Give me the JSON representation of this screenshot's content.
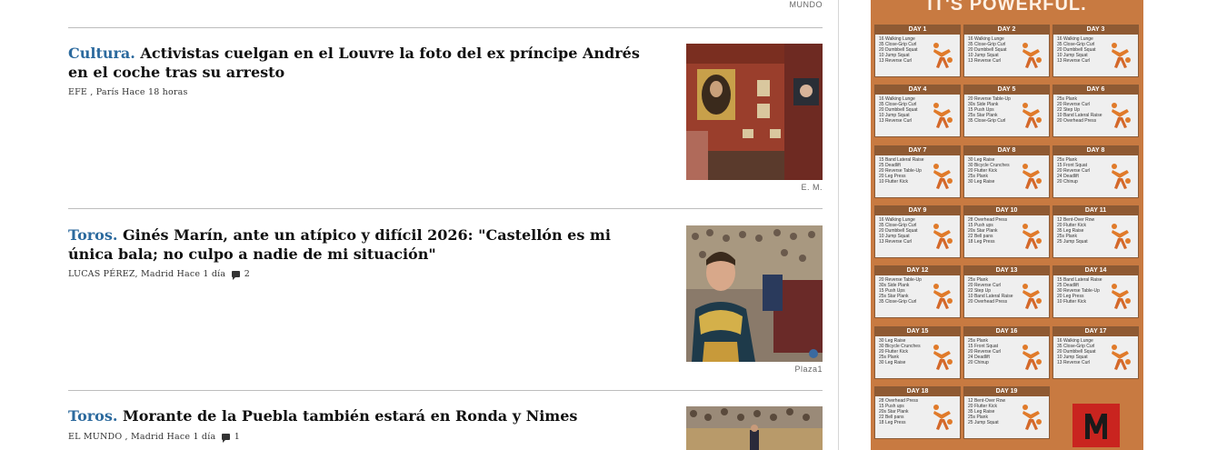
{
  "section": {
    "label": "MUNDO"
  },
  "articles": [
    {
      "kicker": "Cultura.",
      "title": "Activistas cuelgan en el Louvre la foto del ex príncipe Andrés en el coche tras su arresto",
      "byline": "EFE , París",
      "time": "Hace 18 horas",
      "comments": "",
      "credit": "E. M."
    },
    {
      "kicker": "Toros.",
      "title": "Ginés Marín, ante un atípico y difícil 2026: \"Castellón es mi única bala; no culpo a nadie de mi situación\"",
      "byline": "LUCAS PÉREZ, Madrid",
      "time": "Hace 1 día",
      "comments": "2",
      "credit": "Plaza1"
    },
    {
      "kicker": "Toros.",
      "title": "Morante de la Puebla también estará en Ronda y Nimes",
      "byline": "EL MUNDO , Madrid",
      "time": "Hace 1 día",
      "comments": "1",
      "credit": ""
    }
  ],
  "ad": {
    "title": "IT'S POWERFUL.",
    "days": [
      {
        "label": "DAY 1",
        "items": [
          "16 Walking Lunge",
          "35 Close-Grip Curl",
          "20 Dumbbell Squat",
          "10 Jump Squat",
          "13 Reverse Curl"
        ]
      },
      {
        "label": "DAY 2",
        "items": [
          "16 Walking Lunge",
          "35 Close-Grip Curl",
          "20 Dumbbell Squat",
          "10 Jump Squat",
          "13 Reverse Curl"
        ]
      },
      {
        "label": "DAY 3",
        "items": [
          "16 Walking Lunge",
          "35 Close-Grip Curl",
          "20 Dumbbell Squat",
          "10 Jump Squat",
          "13 Reverse Curl"
        ]
      },
      {
        "label": "DAY 4",
        "items": [
          "16 Walking Lunge",
          "35 Close-Grip Curl",
          "20 Dumbbell Squat",
          "10 Jump Squat",
          "13 Reverse Curl"
        ]
      },
      {
        "label": "DAY 5",
        "items": [
          "20 Reverse Table-Up",
          "30s Side Plank",
          "15 Push Ups",
          "25s Star Plank",
          "35 Close-Grip Curl"
        ]
      },
      {
        "label": "DAY 6",
        "items": [
          "25s Plank",
          "20 Reverse Curl",
          "22 Step Up",
          "10 Band Lateral Raise",
          "20 Overhead Press"
        ]
      },
      {
        "label": "DAY 7",
        "items": [
          "15 Band Lateral Raise",
          "25 Deadlift",
          "20 Reverse Table-Up",
          "20 Leg Press",
          "10 Flutter Kick"
        ]
      },
      {
        "label": "DAY 8",
        "items": [
          "30 Leg Raise",
          "30 Bicycle Crunches",
          "20 Flutter Kick",
          "25s Plank",
          "30 Leg Raise"
        ]
      },
      {
        "label": "DAY 8",
        "items": [
          "25s Plank",
          "15 Front Squat",
          "20 Reverse Curl",
          "24 Deadlift",
          "20 Chinup"
        ]
      },
      {
        "label": "DAY 9",
        "items": [
          "16 Walking Lunge",
          "35 Close-Grip Curl",
          "20 Dumbbell Squat",
          "10 Jump Squat",
          "13 Reverse Curl"
        ]
      },
      {
        "label": "DAY 10",
        "items": [
          "28 Overhead Press",
          "15 Push ups",
          "20s Star Plank",
          "22 Bell pans",
          "18 Leg Press"
        ]
      },
      {
        "label": "DAY 11",
        "items": [
          "12 Bent-Over Row",
          "20 Flutter Kick",
          "35 Leg Raise",
          "25s Plank",
          "25 Jump Squat"
        ]
      },
      {
        "label": "DAY 12",
        "items": [
          "20 Reverse Table-Up",
          "30s Side Plank",
          "15 Push Ups",
          "25s Star Plank",
          "35 Close-Grip Curl"
        ]
      },
      {
        "label": "DAY 13",
        "items": [
          "25s Plank",
          "20 Reverse Curl",
          "22 Step Up",
          "10 Band Lateral Raise",
          "20 Overhead Press"
        ]
      },
      {
        "label": "DAY 14",
        "items": [
          "15 Band Lateral Raise",
          "25 Deadlift",
          "30 Reverse Table-Up",
          "20 Leg Press",
          "10 Flutter Kick"
        ]
      },
      {
        "label": "DAY 15",
        "items": [
          "30 Leg Raise",
          "30 Bicycle Crunches",
          "20 Flutter Kick",
          "25s Plank",
          "30 Leg Raise"
        ]
      },
      {
        "label": "DAY 16",
        "items": [
          "25s Plank",
          "15 Front Squat",
          "20 Reverse Curl",
          "24 Deadlift",
          "20 Chinup"
        ]
      },
      {
        "label": "DAY 17",
        "items": [
          "16 Walking Lunge",
          "35 Close-Grip Curl",
          "20 Dumbbell Squat",
          "10 Jump Squat",
          "13 Reverse Curl"
        ]
      },
      {
        "label": "DAY 18",
        "items": [
          "28 Overhead Press",
          "15 Push ups",
          "20s Star Plank",
          "22 Bell pans",
          "18 Leg Press"
        ]
      },
      {
        "label": "DAY 19",
        "items": [
          "12 Bent-Over Row",
          "20 Flutter Kick",
          "35 Leg Raise",
          "25s Plank",
          "25 Jump Squat"
        ]
      }
    ]
  },
  "colors": {
    "kicker": "#2c6a9e",
    "ad_bg": "#c87a41",
    "ad_header": "#8f5a33",
    "logo": "#c9241f"
  },
  "icons": {
    "comment": "comment-icon",
    "logo": "m-logo-icon"
  }
}
